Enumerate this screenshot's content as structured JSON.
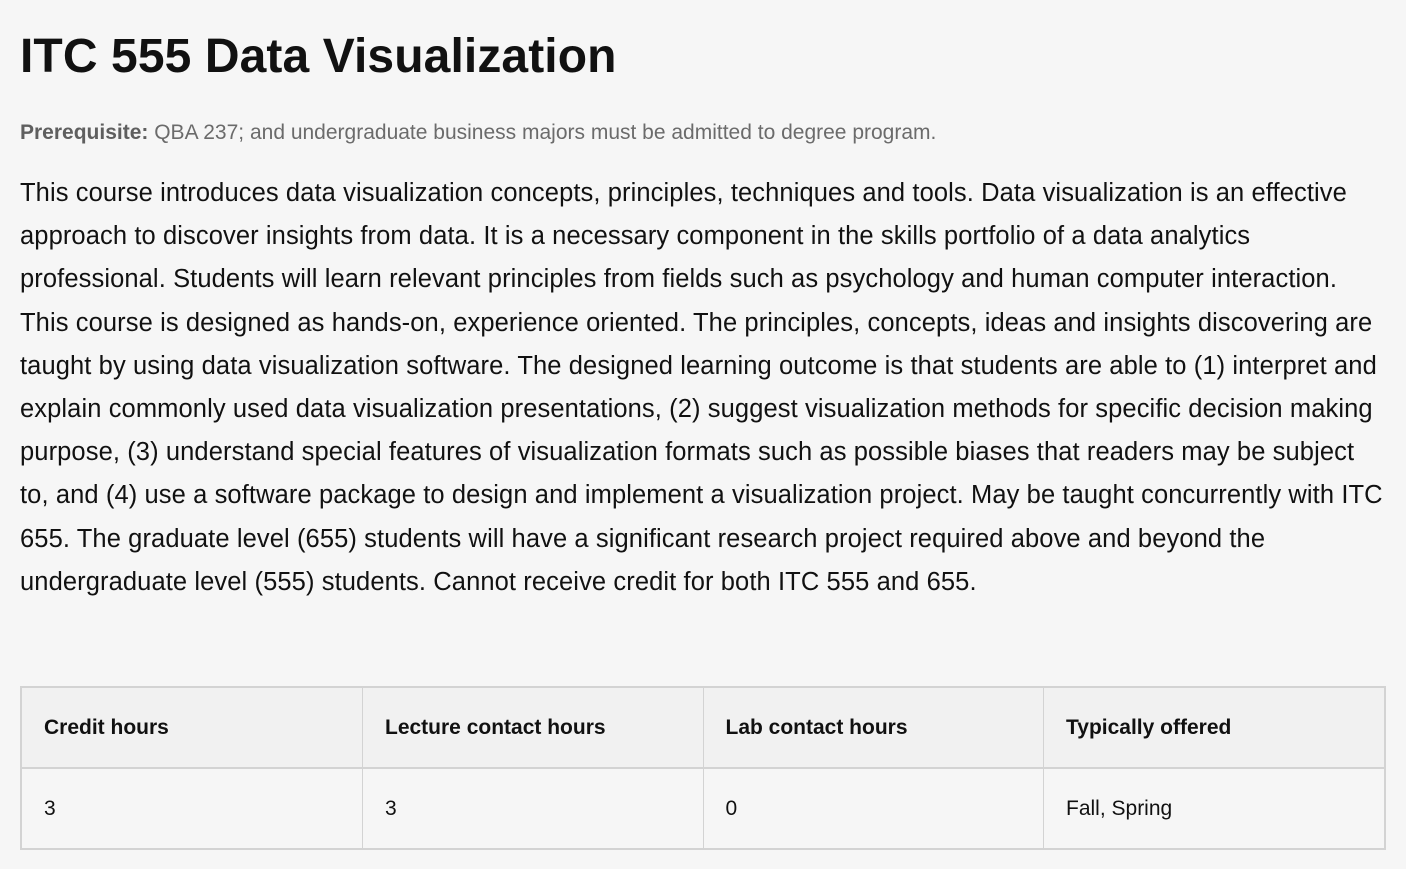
{
  "course": {
    "title": "ITC 555 Data Visualization",
    "prerequisite_label": "Prerequisite:",
    "prerequisite_text": " QBA 237; and undergraduate business majors must be admitted to degree program.",
    "description": "This course introduces data visualization concepts, principles, techniques and tools. Data visualization is an effective approach to discover insights from data. It is a necessary component in the skills portfolio of a data analytics professional. Students will learn relevant principles from fields such as psychology and human computer interaction. This course is designed as hands-on, experience oriented. The principles, concepts, ideas and insights discovering are taught by using data visualization software. The designed learning outcome is that students are able to (1) interpret and explain commonly used data visualization presentations, (2) suggest visualization methods for specific decision making purpose, (3) understand special features of visualization formats such as possible biases that readers may be subject to, and (4) use a software package to design and implement a visualization project. May be taught concurrently with ITC 655. The graduate level (655) students will have a significant research project required above and beyond the undergraduate level (555) students. Cannot receive credit for both ITC 555 and 655."
  },
  "details_table": {
    "headers": [
      "Credit hours",
      "Lecture contact hours",
      "Lab contact hours",
      "Typically offered"
    ],
    "rows": [
      [
        "3",
        "3",
        "0",
        "Fall, Spring"
      ]
    ]
  }
}
